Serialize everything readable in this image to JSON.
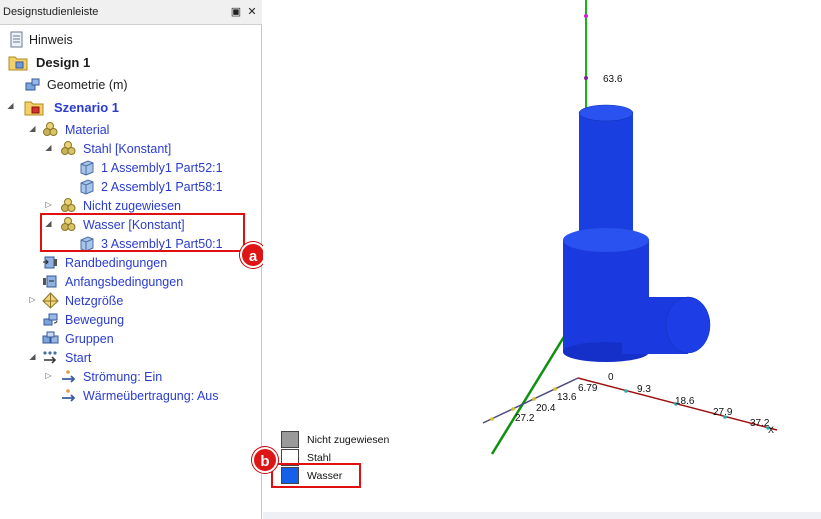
{
  "panel": {
    "title": "Designstudienleiste",
    "pin_glyph": "▣",
    "close_glyph": "✕"
  },
  "tree": {
    "hinweis": "Hinweis",
    "design": "Design 1",
    "geometrie": "Geometrie (m)",
    "szenario": "Szenario 1",
    "material": "Material",
    "stahl": "Stahl [Konstant]",
    "part1": "1 Assembly1  Part52:1",
    "part2": "2 Assembly1  Part58:1",
    "nicht": "Nicht zugewiesen",
    "wasser": "Wasser [Konstant]",
    "part3": "3 Assembly1  Part50:1",
    "rand": "Randbedingungen",
    "anfang": "Anfangsbedingungen",
    "netz": "Netzgröße",
    "bewegung": "Bewegung",
    "gruppen": "Gruppen",
    "start": "Start",
    "stroemung": "Strömung: Ein",
    "waerme": "Wärmeübertragung: Aus"
  },
  "callouts": {
    "a": "a",
    "b": "b"
  },
  "legend": {
    "items": [
      {
        "label": "Nicht zugewiesen",
        "color": "#9a9a9a"
      },
      {
        "label": "Stahl",
        "color": "#ffffff"
      },
      {
        "label": "Wasser",
        "color": "#1560e8"
      }
    ]
  },
  "axes": {
    "y_value": "63.6",
    "origin_value": "0",
    "x_label": "X",
    "x_ticks": [
      "9.3",
      "18.6",
      "27.9",
      "37.2"
    ],
    "z_ticks": [
      "6.79",
      "13.6",
      "20.4",
      "27.2"
    ]
  },
  "colors": {
    "accent_blue": "#2a3cd0",
    "highlight_red": "#e01010",
    "model_blue": "#1a3fe0"
  }
}
